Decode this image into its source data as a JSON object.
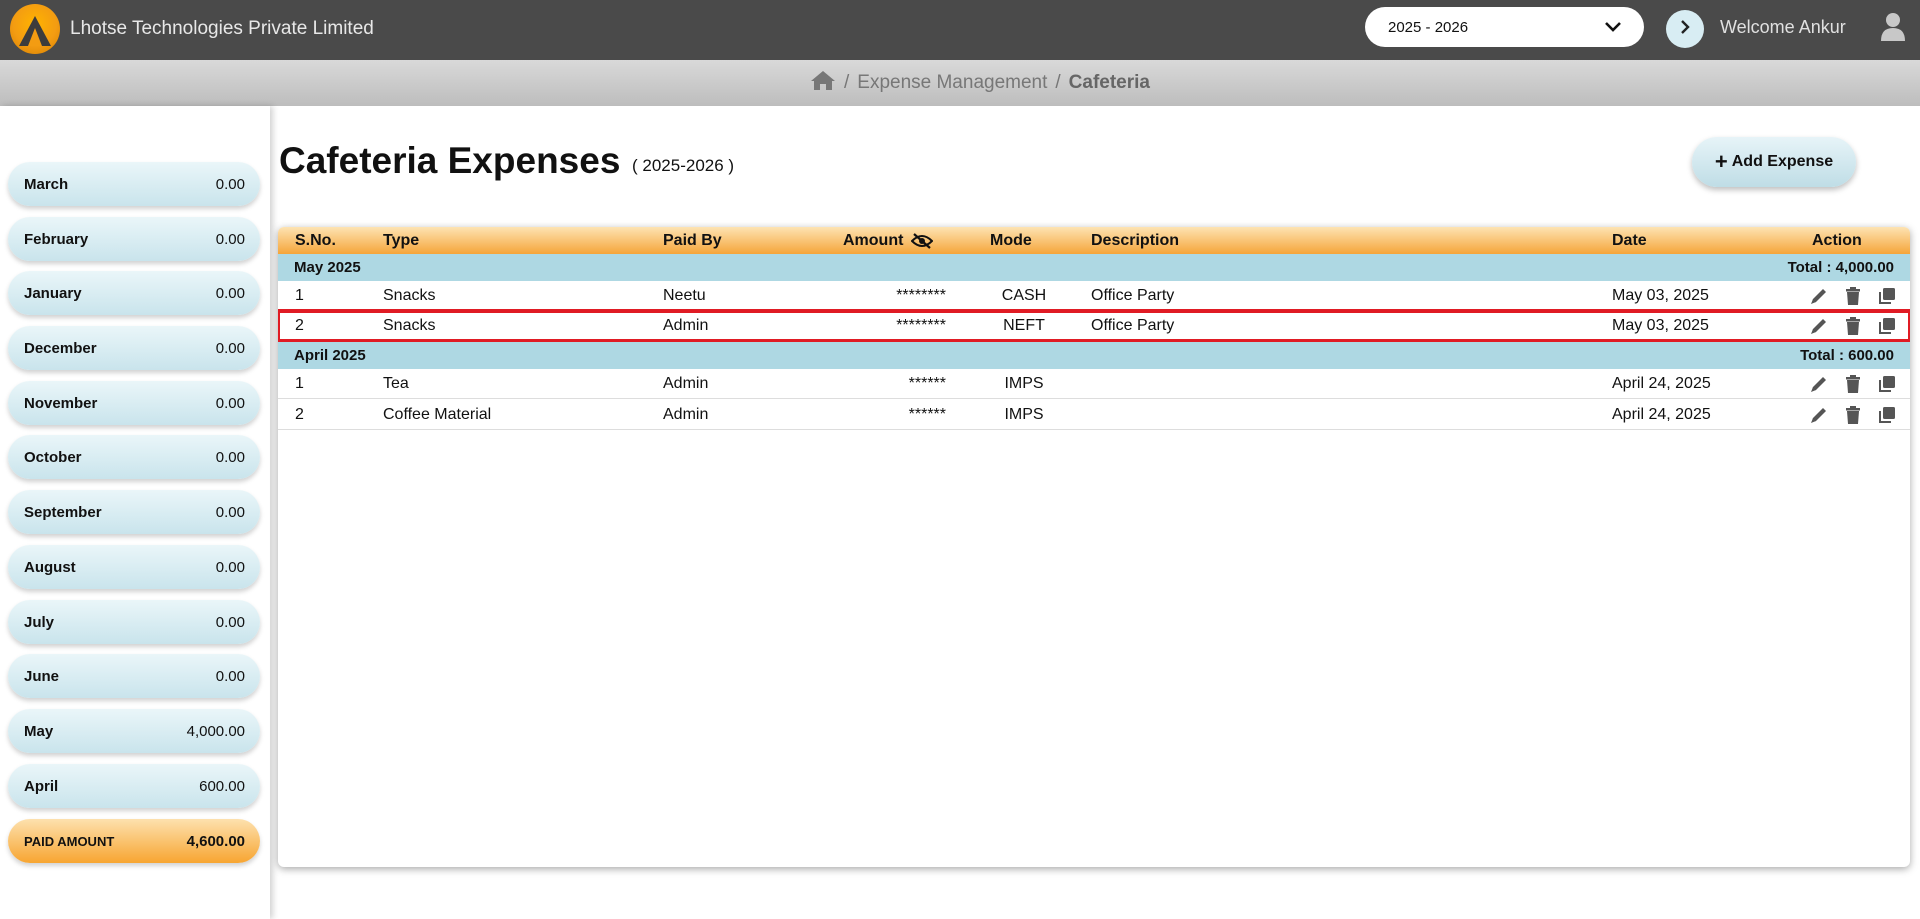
{
  "header": {
    "company": "Lhotse Technologies Private Limited",
    "year_selected": "2025 - 2026",
    "welcome": "Welcome Ankur"
  },
  "breadcrumb": {
    "items": [
      "Expense Management"
    ],
    "current": "Cafeteria"
  },
  "sidebar": {
    "months": [
      {
        "name": "March",
        "value": "0.00"
      },
      {
        "name": "February",
        "value": "0.00"
      },
      {
        "name": "January",
        "value": "0.00"
      },
      {
        "name": "December",
        "value": "0.00"
      },
      {
        "name": "November",
        "value": "0.00"
      },
      {
        "name": "October",
        "value": "0.00"
      },
      {
        "name": "September",
        "value": "0.00"
      },
      {
        "name": "August",
        "value": "0.00"
      },
      {
        "name": "July",
        "value": "0.00"
      },
      {
        "name": "June",
        "value": "0.00"
      },
      {
        "name": "May",
        "value": "4,000.00"
      },
      {
        "name": "April",
        "value": "600.00"
      }
    ],
    "paid": {
      "label": "PAID AMOUNT",
      "value": "4,600.00"
    }
  },
  "main": {
    "title": "Cafeteria Expenses",
    "subtitle": "( 2025-2026 )",
    "add_button": "Add Expense"
  },
  "table": {
    "columns": {
      "sno": "S.No.",
      "type": "Type",
      "paid_by": "Paid By",
      "amount": "Amount",
      "mode": "Mode",
      "description": "Description",
      "date": "Date",
      "action": "Action"
    },
    "groups": [
      {
        "label": "May 2025",
        "total": "Total : 4,000.00",
        "rows": [
          {
            "sno": "1",
            "type": "Snacks",
            "paid_by": "Neetu",
            "amount": "********",
            "mode": "CASH",
            "description": "Office Party",
            "date": "May 03, 2025"
          },
          {
            "sno": "2",
            "type": "Snacks",
            "paid_by": "Admin",
            "amount": "********",
            "mode": "NEFT",
            "description": "Office Party",
            "date": "May 03, 2025"
          }
        ]
      },
      {
        "label": "April 2025",
        "total": "Total : 600.00",
        "rows": [
          {
            "sno": "1",
            "type": "Tea",
            "paid_by": "Admin",
            "amount": "******",
            "mode": "IMPS",
            "description": "",
            "date": "April 24, 2025"
          },
          {
            "sno": "2",
            "type": "Coffee Material",
            "paid_by": "Admin",
            "amount": "******",
            "mode": "IMPS",
            "description": "",
            "date": "April 24, 2025"
          }
        ]
      }
    ]
  },
  "colors": {
    "topbar": "#4a4a4a",
    "accent_orange": "#f5a53a",
    "group_blue": "#aed8e3",
    "highlight": "#e01b24"
  }
}
